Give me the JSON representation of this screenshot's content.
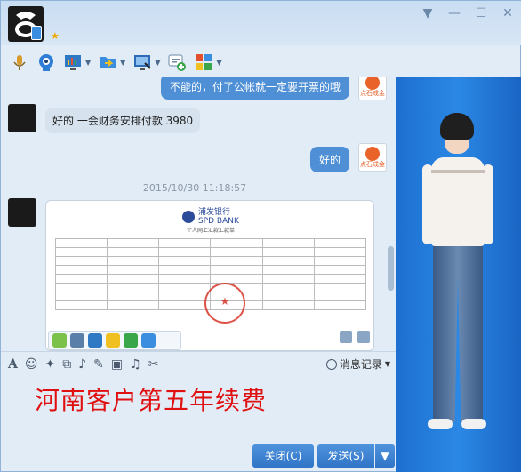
{
  "titlebar": {
    "contact_status_icon": "star-icon",
    "window_buttons": [
      "▼",
      "—",
      "☐",
      "✕"
    ]
  },
  "toolbar": {
    "items": [
      {
        "name": "voice-call",
        "icon": "microphone-icon",
        "color": "#d89a2a",
        "has_menu": false
      },
      {
        "name": "video-call",
        "icon": "webcam-icon",
        "color": "#2e7dd6",
        "has_menu": false
      },
      {
        "name": "remote-desktop",
        "icon": "screen-share-icon",
        "color": "#2f78c4",
        "has_menu": true
      },
      {
        "name": "send-file",
        "icon": "folder-send-icon",
        "color": "#3b8de0",
        "has_menu": true
      },
      {
        "name": "remote-assist",
        "icon": "monitor-icon",
        "color": "#2f6bb5",
        "has_menu": true
      },
      {
        "name": "create-discussion",
        "icon": "chat-add-icon",
        "color": "#3aa64a",
        "has_menu": false
      },
      {
        "name": "apps",
        "icon": "apps-grid-icon",
        "color": "#e2502e",
        "has_menu": true
      }
    ]
  },
  "chat": {
    "messages": [
      {
        "side": "right",
        "text": "不能的，付了公帐就一定要开票的哦"
      },
      {
        "side": "left",
        "text": "好的 一会财务安排付款 3980"
      },
      {
        "side": "right",
        "text": "好的"
      }
    ],
    "timestamp": "2015/10/30 11:18:57",
    "sender_brand": "点石成金",
    "document": {
      "bank_name": "浦发银行",
      "bank_name_en": "SPD BANK",
      "subtitle": "个人网上汇款汇款单"
    }
  },
  "input_toolbar": {
    "icons": [
      "font-icon",
      "emoji-icon",
      "magic-icon",
      "screenshot-icon",
      "voice-message-icon",
      "edit-icon",
      "image-icon",
      "music-icon",
      "scissors-icon"
    ],
    "history_label": "消息记录"
  },
  "input": {
    "text": "河南客户第五年续费",
    "color": "#e01010"
  },
  "buttons": {
    "close_label": "关闭(C)",
    "send_label": "发送(S)",
    "send_menu": "▼"
  }
}
